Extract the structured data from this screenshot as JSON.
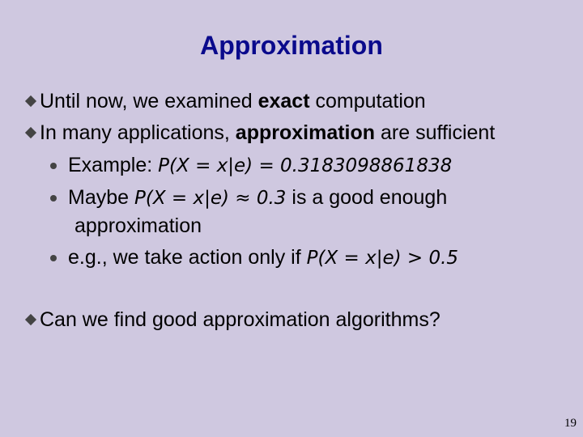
{
  "title": "Approximation",
  "bullets": {
    "b1": {
      "pre": "Until now, we examined ",
      "bold": "exact",
      "post": " computation"
    },
    "b2": {
      "pre": "In many applications, ",
      "bold": "approximation",
      "post": " are sufficient"
    },
    "s1": {
      "pre": "Example: ",
      "math": "P(X = x|e) =  0.3183098861838"
    },
    "s2": {
      "pre": "Maybe ",
      "math": "P(X = x|e) ≈ 0.3",
      "post": " is a good enough",
      "cont": "approximation"
    },
    "s3": {
      "pre": "e.g., we take action only if ",
      "math": "P(X = x|e) > 0.5"
    },
    "b3": {
      "text": "Can we find good approximation algorithms?"
    }
  },
  "page_number": "19"
}
